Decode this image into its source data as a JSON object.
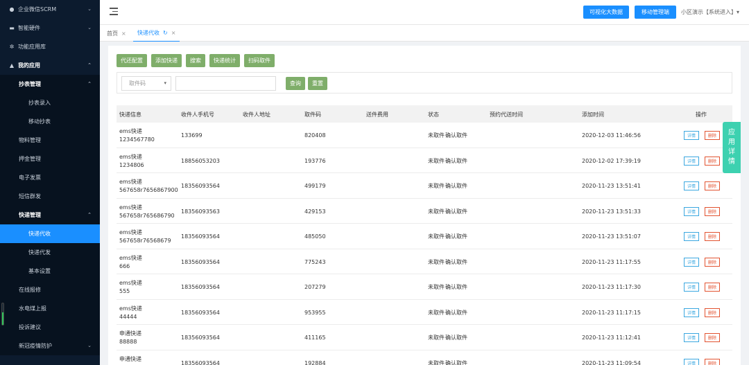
{
  "sidebar": {
    "items": [
      {
        "label": "企业微信SCRM",
        "icon": "chat-icon",
        "arrow": "chevron-down-icon"
      },
      {
        "label": "智能硬件",
        "icon": "device-icon",
        "arrow": "chevron-down-icon"
      },
      {
        "label": "功能应用库",
        "icon": "gear-icon"
      },
      {
        "label": "我的应用",
        "icon": "user-icon",
        "arrow": "chevron-up-icon"
      },
      {
        "label": "抄表管理",
        "arrow": "chevron-up-icon"
      },
      {
        "label": "抄表录入"
      },
      {
        "label": "移动抄表"
      },
      {
        "label": "物料管理"
      },
      {
        "label": "押金管理"
      },
      {
        "label": "电子发票"
      },
      {
        "label": "短信群发"
      },
      {
        "label": "快递管理",
        "arrow": "chevron-up-icon"
      },
      {
        "label": "快递代收"
      },
      {
        "label": "快递代发"
      },
      {
        "label": "基本设置"
      },
      {
        "label": "在线报修"
      },
      {
        "label": "水电煤上报"
      },
      {
        "label": "投诉建议"
      },
      {
        "label": "新冠疫情防护",
        "arrow": "chevron-down-icon"
      }
    ]
  },
  "topbar": {
    "big_data_button": "可视化大数据",
    "mobile_admin_button": "移动管理端",
    "user_menu": "小区演示【系统进入】▾"
  },
  "tabs": [
    {
      "label": "首页",
      "close": "×"
    },
    {
      "label": "快递代收",
      "refresh": "↻",
      "close": "×"
    }
  ],
  "actions": [
    "代还配置",
    "添加快递",
    "搜索",
    "快递统计",
    "扫码取件"
  ],
  "search": {
    "select_value": "取件码",
    "input_value": "",
    "query_button": "查询",
    "reset_button": "重置"
  },
  "side_tab": [
    "应",
    "用",
    "详",
    "情"
  ],
  "table": {
    "headers": [
      "快递信息",
      "收件人手机号",
      "收件人地址",
      "取件码",
      "送件费用",
      "状态",
      "预约代送时间",
      "添加时间",
      "操作"
    ],
    "rows": [
      {
        "info1": "ems快递",
        "info2": "1234567780",
        "phone": "133699",
        "address": "",
        "code": "820408",
        "fee": "",
        "status": "未取件",
        "confirm": "确认取件",
        "reserve": "",
        "time": "2020-12-03 11:46:56"
      },
      {
        "info1": "ems快递",
        "info2": "1234806",
        "phone": "18856053203",
        "address": "",
        "code": "193776",
        "fee": "",
        "status": "未取件",
        "confirm": "确认取件",
        "reserve": "",
        "time": "2020-12-02 17:39:19"
      },
      {
        "info1": "ems快递",
        "info2": "567658r7656867900",
        "phone": "18356093564",
        "address": "",
        "code": "499179",
        "fee": "",
        "status": "未取件",
        "confirm": "确认取件",
        "reserve": "",
        "time": "2020-11-23 13:51:41"
      },
      {
        "info1": "ems快递",
        "info2": "567658r765686790",
        "phone": "18356093563",
        "address": "",
        "code": "429153",
        "fee": "",
        "status": "未取件",
        "confirm": "确认取件",
        "reserve": "",
        "time": "2020-11-23 13:51:33"
      },
      {
        "info1": "ems快递",
        "info2": "567658r76568679",
        "phone": "18356093564",
        "address": "",
        "code": "485050",
        "fee": "",
        "status": "未取件",
        "confirm": "确认取件",
        "reserve": "",
        "time": "2020-11-23 13:51:07"
      },
      {
        "info1": "ems快递",
        "info2": "666",
        "phone": "18356093564",
        "address": "",
        "code": "775243",
        "fee": "",
        "status": "未取件",
        "confirm": "确认取件",
        "reserve": "",
        "time": "2020-11-23 11:17:55"
      },
      {
        "info1": "ems快递",
        "info2": "555",
        "phone": "18356093564",
        "address": "",
        "code": "207279",
        "fee": "",
        "status": "未取件",
        "confirm": "确认取件",
        "reserve": "",
        "time": "2020-11-23 11:17:30"
      },
      {
        "info1": "ems快递",
        "info2": "44444",
        "phone": "18356093564",
        "address": "",
        "code": "953955",
        "fee": "",
        "status": "未取件",
        "confirm": "确认取件",
        "reserve": "",
        "time": "2020-11-23 11:17:15"
      },
      {
        "info1": "申通快递",
        "info2": "88888",
        "phone": "18356093564",
        "address": "",
        "code": "411165",
        "fee": "",
        "status": "未取件",
        "confirm": "确认取件",
        "reserve": "",
        "time": "2020-11-23 11:12:41"
      },
      {
        "info1": "申通快递",
        "info2": "",
        "phone": "18356093564",
        "address": "",
        "code": "192884",
        "fee": "",
        "status": "未取件",
        "confirm": "确认取件",
        "reserve": "",
        "time": "2020-11-23 11:09:54"
      }
    ],
    "detail_label": "详情",
    "delete_label": "删除"
  }
}
